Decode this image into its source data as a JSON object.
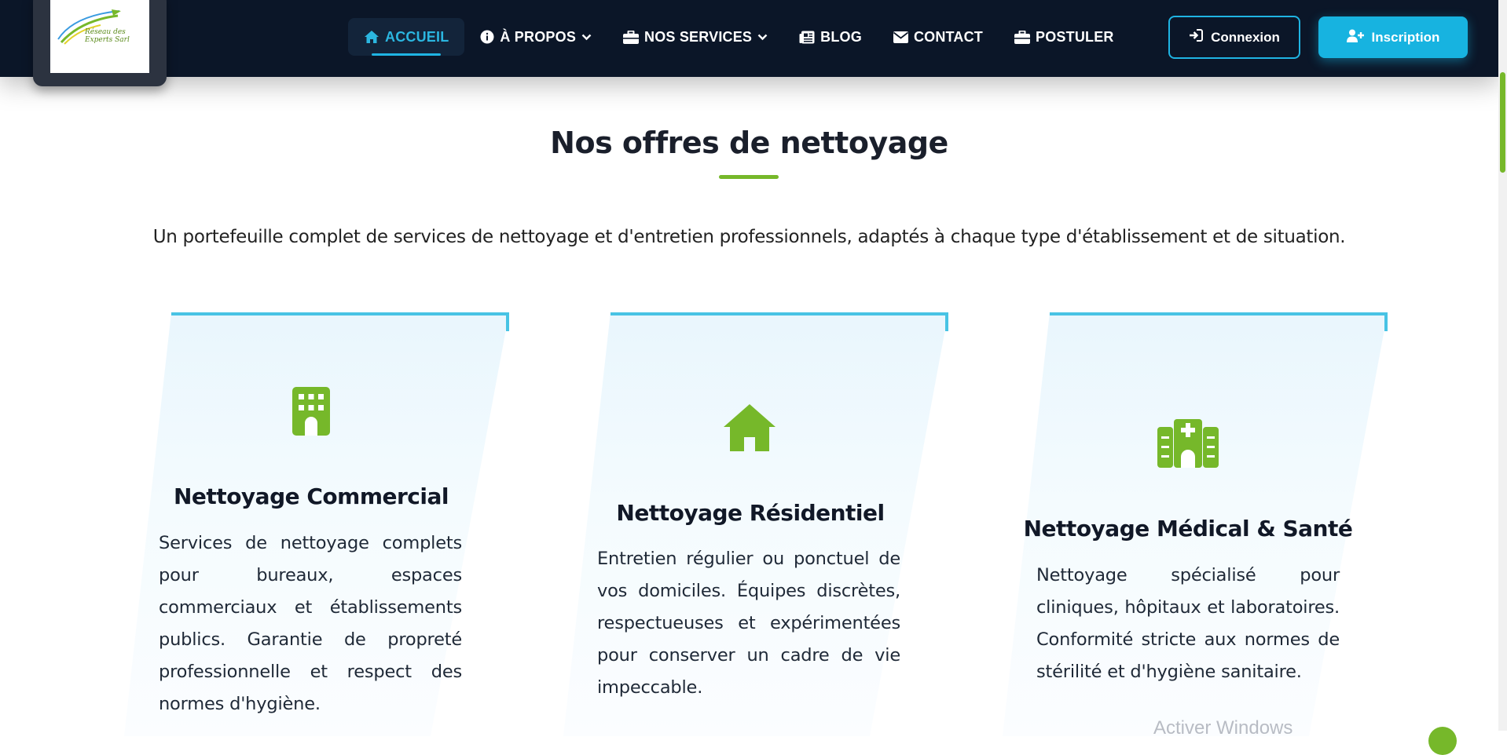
{
  "nav": {
    "items": [
      {
        "label": "ACCUEIL",
        "icon": "home-icon",
        "active": true
      },
      {
        "label": "À PROPOS",
        "icon": "info-circle-icon",
        "dropdown": true
      },
      {
        "label": "NOS SERVICES",
        "icon": "briefcase-icon",
        "dropdown": true
      },
      {
        "label": "BLOG",
        "icon": "newspaper-icon"
      },
      {
        "label": "CONTACT",
        "icon": "envelope-icon"
      },
      {
        "label": "POSTULER",
        "icon": "briefcase-icon"
      }
    ],
    "connexion_label": "Connexion",
    "inscription_label": "Inscription"
  },
  "logo": {
    "line1": "Réseau des",
    "line2": "Experts Sarl"
  },
  "colors": {
    "nav_bg": "#0b1628",
    "accent_blue": "#17b3e0",
    "accent_green": "#76b82a",
    "card_top_border": "#48c3e4"
  },
  "section": {
    "title": "Nos offres de nettoyage",
    "description": "Un portefeuille complet de services de nettoyage et d'entretien professionnels, adaptés à chaque type d'établissement et de situation."
  },
  "cards": [
    {
      "icon": "building-icon",
      "title": "Nettoyage Commercial",
      "text": "Services de nettoyage complets pour bureaux, espaces commerciaux et établissements publics. Garantie de propreté professionnelle et respect des normes d'hygiène."
    },
    {
      "icon": "house-icon",
      "title": "Nettoyage Résidentiel",
      "text": "Entretien régulier ou ponctuel de vos domiciles. Équipes discrètes, respectueuses et expérimentées pour conserver un cadre de vie impeccable."
    },
    {
      "icon": "hospital-icon",
      "title": "Nettoyage Médical & Santé",
      "text": "Nettoyage spécialisé pour cliniques, hôpitaux et laboratoires. Conformité stricte aux normes de stérilité et d'hygiène sanitaire."
    }
  ],
  "watermark": "Activer Windows"
}
